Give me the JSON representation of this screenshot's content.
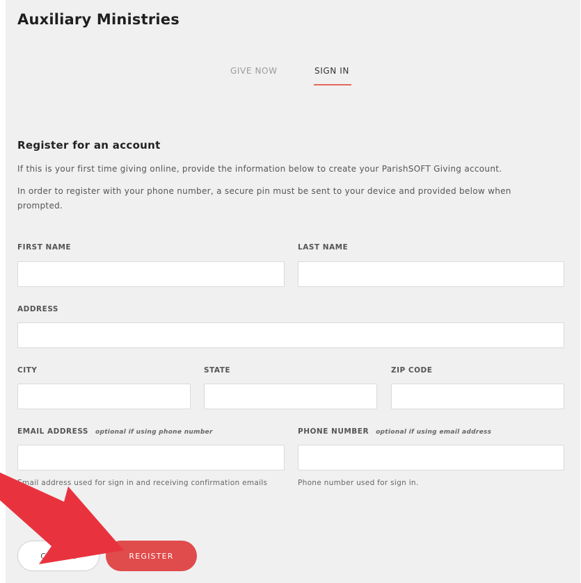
{
  "page": {
    "title": "Auxiliary Ministries"
  },
  "tabs": [
    {
      "label": "GIVE NOW",
      "active": false
    },
    {
      "label": "SIGN IN",
      "active": true
    }
  ],
  "register": {
    "title": "Register for an account",
    "intro": "If this is your first time giving online, provide the information below to create your ParishSOFT Giving account.",
    "phone_note": "In order to register with your phone number, a secure pin must be sent to your device and provided below when prompted."
  },
  "form": {
    "first_name": {
      "label": "FIRST NAME",
      "value": ""
    },
    "last_name": {
      "label": "LAST NAME",
      "value": ""
    },
    "address": {
      "label": "ADDRESS",
      "value": ""
    },
    "city": {
      "label": "CITY",
      "value": ""
    },
    "state": {
      "label": "STATE",
      "value": ""
    },
    "zip": {
      "label": "ZIP CODE",
      "value": ""
    },
    "email": {
      "label": "EMAIL ADDRESS",
      "hint": "optional if using phone number",
      "help": "Email address used for sign in and receiving confirmation emails",
      "value": ""
    },
    "phone": {
      "label": "PHONE NUMBER",
      "hint": "optional if using email address",
      "help": "Phone number used for sign in.",
      "value": ""
    }
  },
  "buttons": {
    "cancel": "CANCEL",
    "register": "REGISTER"
  },
  "colors": {
    "accent": "#e04b4b",
    "tab_underline": "#e4665c",
    "arrow": "#e8333f",
    "background": "#f0f0f0"
  }
}
